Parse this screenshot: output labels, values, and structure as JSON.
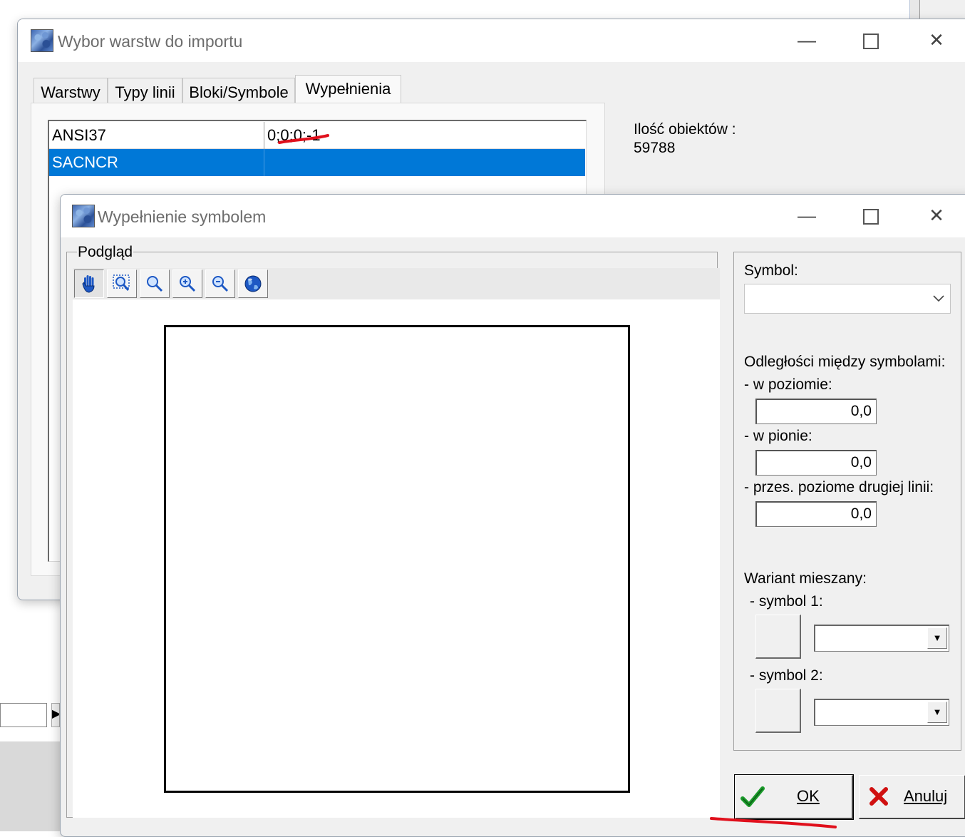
{
  "main_window": {
    "title": "Wybor warstw do importu",
    "tabs": [
      {
        "label": "Warstwy"
      },
      {
        "label": "Typy linii"
      },
      {
        "label": "Bloki/Symbole"
      },
      {
        "label": "Wypełnienia"
      }
    ],
    "active_tab": "Wypełnienia",
    "list_rows": [
      {
        "name": "ANSI37",
        "value": "0;0;0;-1"
      },
      {
        "name": "SACNCR",
        "value": "",
        "selected": true
      }
    ],
    "count_label": "Ilość obiektów :",
    "count_value": "59788"
  },
  "fill_window": {
    "title": "Wypełnienie symbolem",
    "preview_group_label": "Podgląd",
    "toolbar": [
      {
        "icon": "hand-pan-icon"
      },
      {
        "icon": "zoom-window-icon"
      },
      {
        "icon": "zoom-icon"
      },
      {
        "icon": "zoom-in-icon"
      },
      {
        "icon": "zoom-out-icon"
      },
      {
        "icon": "globe-zoom-extents-icon"
      }
    ],
    "symbol_label": "Symbol:",
    "symbol_value": "",
    "spacing_label": "Odległości między symbolami:",
    "horizontal_label": "- w poziomie:",
    "horizontal_value": "0,0",
    "vertical_label": "- w pionie:",
    "vertical_value": "0,0",
    "offset_label": "- przes. poziome drugiej linii:",
    "offset_value": "0,0",
    "mixed_label": "Wariant mieszany:",
    "symbol1_label": "- symbol 1:",
    "symbol2_label": "- symbol 2:",
    "ok_label": "OK",
    "cancel_label": "Anuluj"
  },
  "colors": {
    "selection": "#0078d7",
    "annotation_red": "#e0101c",
    "ok_check": "#1a9a2a",
    "cancel_x": "#d01010"
  }
}
